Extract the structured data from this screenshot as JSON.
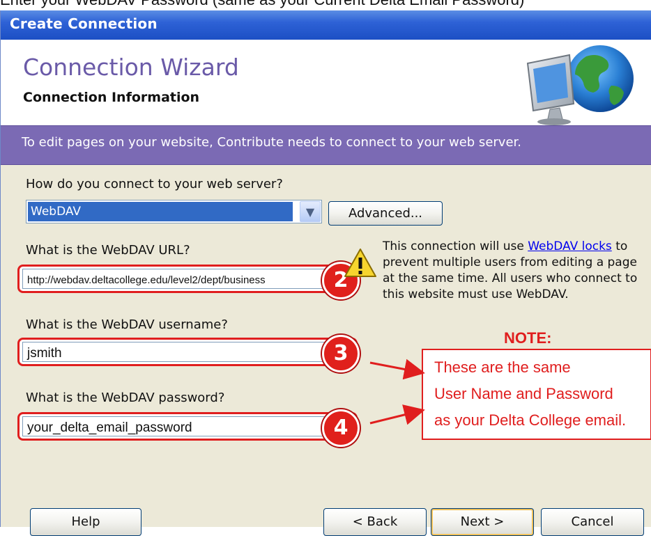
{
  "caption": "Enter your WebDAV Password (same as your Current Delta Email Password)",
  "window": {
    "title": "Create Connection"
  },
  "header": {
    "title": "Connection Wizard",
    "subtitle": "Connection Information"
  },
  "banner": {
    "text": "To edit pages on your website, Contribute needs to connect to your web server."
  },
  "connect_method": {
    "label": "How do you connect to your web server?",
    "selected": "WebDAV",
    "advanced_button": "Advanced..."
  },
  "url_field": {
    "label": "What is the WebDAV URL?",
    "value": "http://webdav.deltacollege.edu/level2/dept/business",
    "badge": "2"
  },
  "username_field": {
    "label": "What is the WebDAV username?",
    "value": "jsmith",
    "badge": "3"
  },
  "password_field": {
    "label": "What is the WebDAV password?",
    "value": "your_delta_email_password",
    "badge": "4"
  },
  "info": {
    "pre": "This connection will use ",
    "link": "WebDAV locks",
    "post": " to prevent multiple users from editing a page at the same time. All users who connect to this website must use WebDAV."
  },
  "note": {
    "title": "NOTE:",
    "lines": [
      "These are the same",
      "User Name and Password",
      "as your Delta College email."
    ]
  },
  "buttons": {
    "help": "Help",
    "back": "< Back",
    "next": "Next >",
    "cancel": "Cancel"
  },
  "colors": {
    "titlebar": "#2e62d6",
    "banner": "#7b6ab4",
    "annotation_red": "#e01e1e",
    "selection": "#316ac5"
  }
}
